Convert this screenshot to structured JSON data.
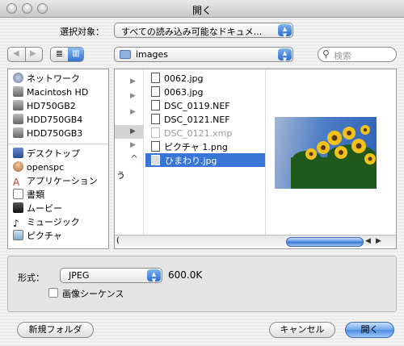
{
  "window": {
    "title": "開く"
  },
  "filter": {
    "label": "選択対象：",
    "value": "すべての読み込み可能なドキュメ..."
  },
  "location": {
    "folder": "images"
  },
  "search": {
    "placeholder": "検索"
  },
  "sidebar": {
    "devices": [
      "ネットワーク",
      "Macintosh HD",
      "HD750GB2",
      "HDD750GB4",
      "HDD750GB3"
    ],
    "places": [
      "デスクトップ",
      "openspc",
      "アプリケーション",
      "書類",
      "ムービー",
      "ミュージック",
      "ピクチャ"
    ]
  },
  "column2": {
    "files": [
      "0062.jpg",
      "0063.jpg",
      "DSC_0119.NEF",
      "DSC_0121.NEF",
      "DSC_0121.xmp",
      "ピクチャ 1.png",
      "ひまわり.jpg"
    ],
    "selected": "ひまわり.jpg"
  },
  "column1": {
    "partial_label": "う"
  },
  "format": {
    "label": "形式：",
    "value": "JPEG",
    "size": "600.0K"
  },
  "sequence": {
    "label": "画像シーケンス",
    "checked": false
  },
  "buttons": {
    "new_folder": "新規フォルダ",
    "cancel": "キャンセル",
    "open": "開く"
  },
  "colors": {
    "accent": "#3d76d6",
    "selection": "#3875d7"
  }
}
